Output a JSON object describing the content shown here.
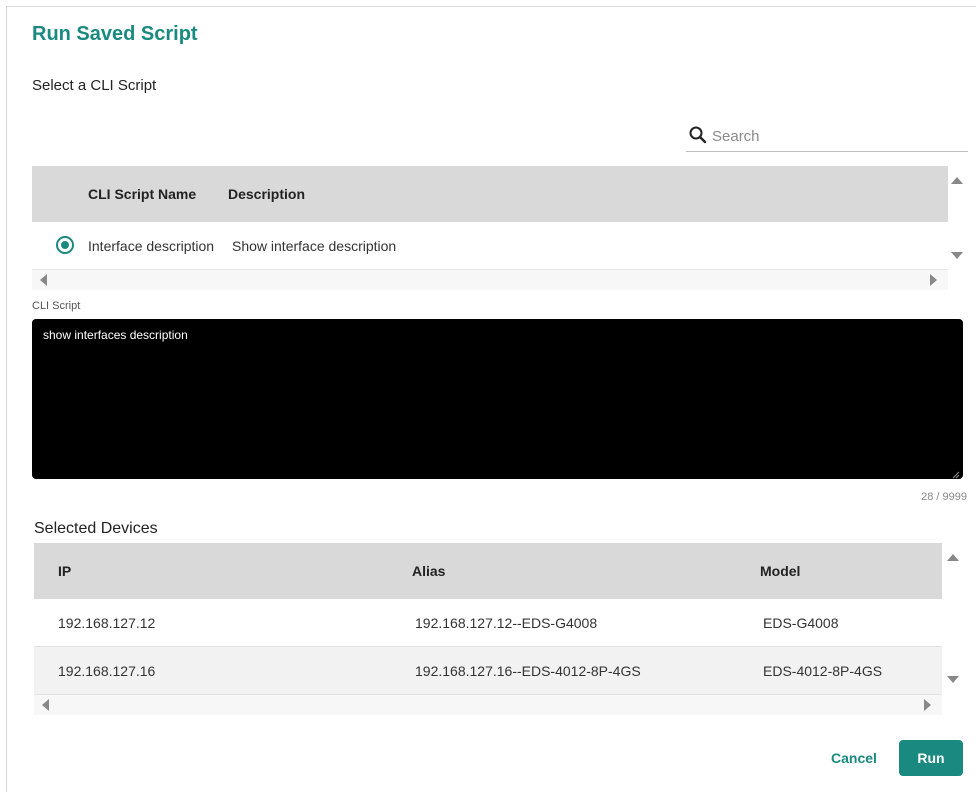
{
  "dialog": {
    "title": "Run Saved Script",
    "subtitle": "Select a CLI Script"
  },
  "search": {
    "placeholder": "Search",
    "value": ""
  },
  "script_table": {
    "columns": [
      "CLI Script Name",
      "Description"
    ],
    "rows": [
      {
        "selected": true,
        "name": "Interface description",
        "description": "Show interface description"
      }
    ]
  },
  "cli": {
    "label": "CLI Script",
    "content": "show interfaces description",
    "counter": "28 / 9999"
  },
  "devices": {
    "title": "Selected Devices",
    "columns": [
      "IP",
      "Alias",
      "Model"
    ],
    "rows": [
      {
        "ip": "192.168.127.12",
        "alias": "192.168.127.12--EDS-G4008",
        "model": "EDS-G4008"
      },
      {
        "ip": "192.168.127.16",
        "alias": "192.168.127.16--EDS-4012-8P-4GS",
        "model": "EDS-4012-8P-4GS"
      }
    ]
  },
  "buttons": {
    "cancel": "Cancel",
    "run": "Run"
  },
  "colors": {
    "accent": "#1a8a80",
    "header_bg": "#d9d9d9",
    "editor_bg": "#000000"
  },
  "icons": {
    "search": "search-icon"
  }
}
